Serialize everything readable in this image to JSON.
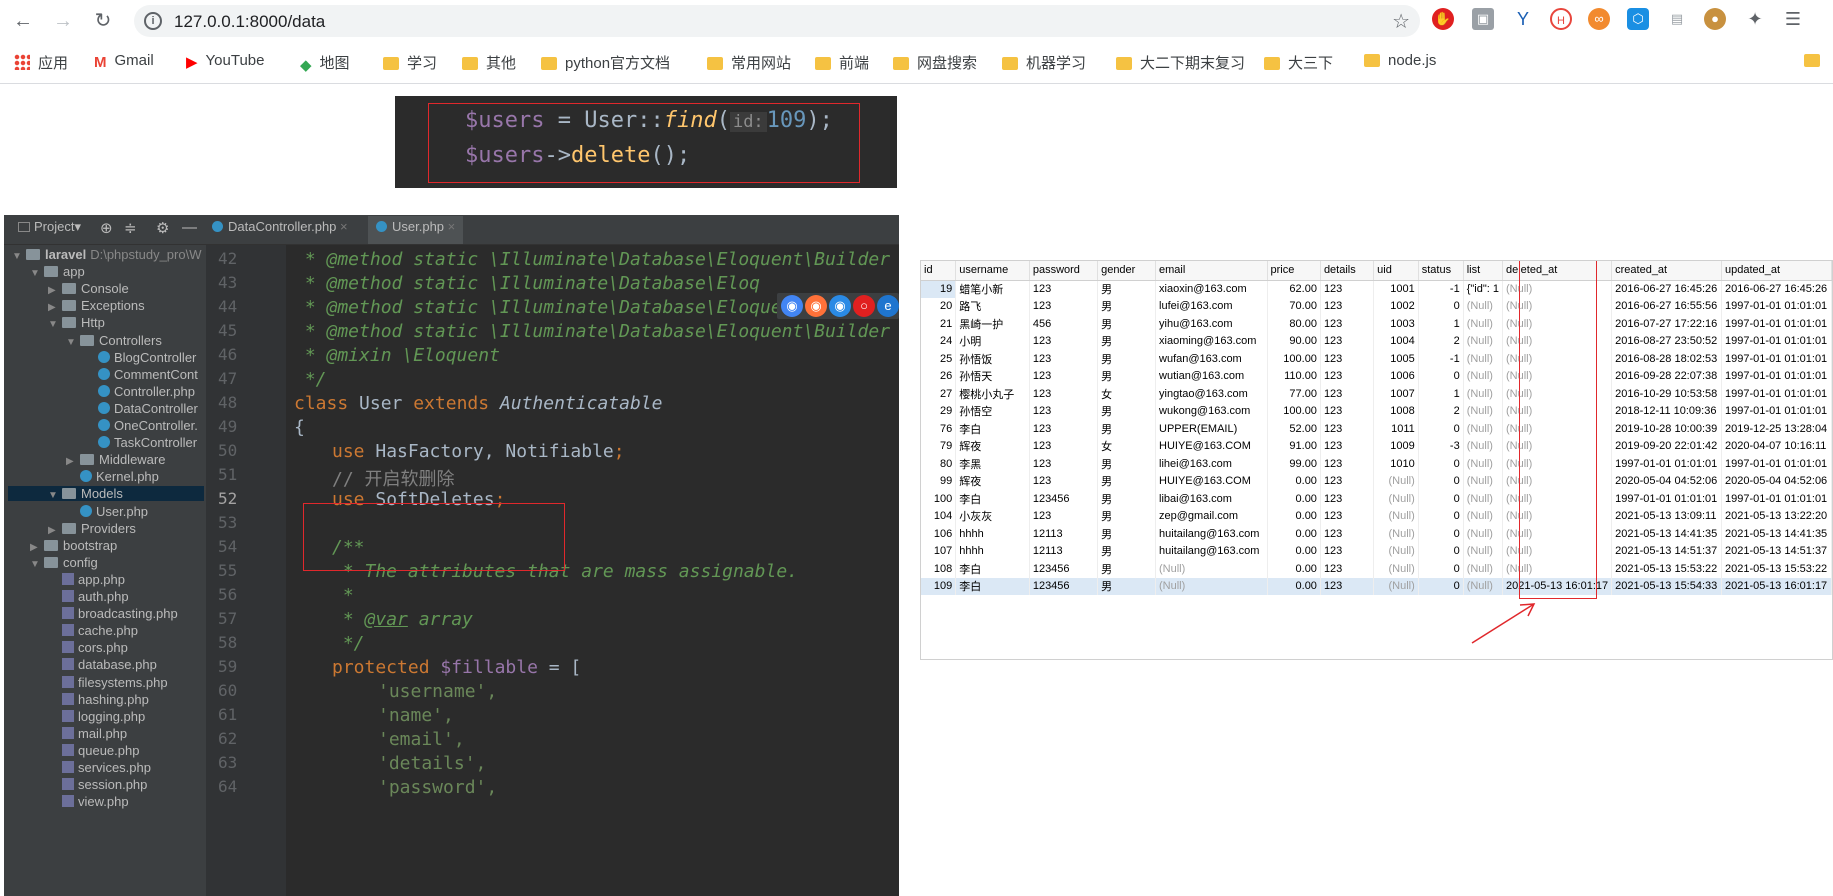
{
  "browser": {
    "url_host": "127.0.0.1",
    "url_path": ":8000/data",
    "bookmarks": [
      "应用",
      "Gmail",
      "YouTube",
      "地图",
      "学习",
      "其他",
      "python官方文档",
      "常用网站",
      "前端",
      "网盘搜索",
      "机器学习",
      "大二下期末复习",
      "大三下",
      "node.js"
    ]
  },
  "snippet": {
    "line1_var": "$users",
    "line1_eq": " = ",
    "line1_cls": "User",
    "line1_op": "::",
    "line1_fn": "find",
    "line1_open": "(",
    "line1_hint": "id:",
    "line1_num": "109",
    "line1_close": ");",
    "line2_var": "$users",
    "line2_arrow": "->",
    "line2_fn": "delete",
    "line2_end": "();"
  },
  "ide": {
    "project_label": "Project▾",
    "tabs": [
      "DataController.php",
      "User.php"
    ],
    "tree": [
      {
        "label": "laravel",
        "extra": "D:\\phpstudy_pro\\W",
        "type": "folder",
        "depth": 0,
        "open": true
      },
      {
        "label": "app",
        "type": "folder",
        "depth": 1,
        "open": true
      },
      {
        "label": "Console",
        "type": "folder",
        "depth": 2,
        "open": false
      },
      {
        "label": "Exceptions",
        "type": "folder",
        "depth": 2,
        "open": false
      },
      {
        "label": "Http",
        "type": "folder",
        "depth": 2,
        "open": true
      },
      {
        "label": "Controllers",
        "type": "folder",
        "depth": 3,
        "open": true
      },
      {
        "label": "BlogController",
        "type": "class",
        "depth": 4
      },
      {
        "label": "CommentCont",
        "type": "class",
        "depth": 4
      },
      {
        "label": "Controller.php",
        "type": "class",
        "depth": 4
      },
      {
        "label": "DataController",
        "type": "class",
        "depth": 4
      },
      {
        "label": "OneController.",
        "type": "class",
        "depth": 4
      },
      {
        "label": "TaskController",
        "type": "class",
        "depth": 4
      },
      {
        "label": "Middleware",
        "type": "folder",
        "depth": 3,
        "open": false
      },
      {
        "label": "Kernel.php",
        "type": "class",
        "depth": 3
      },
      {
        "label": "Models",
        "type": "folder",
        "depth": 2,
        "open": true,
        "selected": true
      },
      {
        "label": "User.php",
        "type": "class",
        "depth": 3
      },
      {
        "label": "Providers",
        "type": "folder",
        "depth": 2,
        "open": false
      },
      {
        "label": "bootstrap",
        "type": "folder",
        "depth": 1,
        "open": false
      },
      {
        "label": "config",
        "type": "folder",
        "depth": 1,
        "open": true
      },
      {
        "label": "app.php",
        "type": "php",
        "depth": 2
      },
      {
        "label": "auth.php",
        "type": "php",
        "depth": 2
      },
      {
        "label": "broadcasting.php",
        "type": "php",
        "depth": 2
      },
      {
        "label": "cache.php",
        "type": "php",
        "depth": 2
      },
      {
        "label": "cors.php",
        "type": "php",
        "depth": 2
      },
      {
        "label": "database.php",
        "type": "php",
        "depth": 2
      },
      {
        "label": "filesystems.php",
        "type": "php",
        "depth": 2
      },
      {
        "label": "hashing.php",
        "type": "php",
        "depth": 2
      },
      {
        "label": "logging.php",
        "type": "php",
        "depth": 2
      },
      {
        "label": "mail.php",
        "type": "php",
        "depth": 2
      },
      {
        "label": "queue.php",
        "type": "php",
        "depth": 2
      },
      {
        "label": "services.php",
        "type": "php",
        "depth": 2
      },
      {
        "label": "session.php",
        "type": "php",
        "depth": 2
      },
      {
        "label": "view.php",
        "type": "php",
        "depth": 2
      }
    ],
    "line_numbers": [
      "42",
      "43",
      "44",
      "45",
      "46",
      "47",
      "48",
      "49",
      "50",
      "51",
      "52",
      "53",
      "54",
      "55",
      "56",
      "57",
      "58",
      "59",
      "60",
      "61",
      "62",
      "63",
      "64"
    ],
    "code": {
      "l42": " * @method static \\Illuminate\\Database\\Eloquent\\Builder",
      "l43": " * @method static \\Illuminate\\Database\\Eloq",
      "l44": " * @method static \\Illuminate\\Database\\Eloquent\\Builder",
      "l45": " * @method static \\Illuminate\\Database\\Eloquent\\Builder",
      "l46": " * @mixin \\Eloquent",
      "l47": " */",
      "l48_kw": "class",
      "l48_name": " User ",
      "l48_ext": "extends",
      "l48_parent": " Authenticatable",
      "l49": "{",
      "l50_kw": "use",
      "l50_rest": " HasFactory, Notifiable",
      "l50_semi": ";",
      "l51": "// 开启软删除",
      "l52_kw": "use",
      "l52_rest": " SoftDeletes",
      "l52_semi": ";",
      "l54": "/**",
      "l55": " * The attributes that are mass assignable.",
      "l56": " *",
      "l57_tag": "@var",
      "l57_rest": " array",
      "l58": " */",
      "l59_kw": "protected",
      "l59_var": " $fillable",
      "l59_rest": " = [",
      "l60": "'username',",
      "l61": "'name',",
      "l62": "'email',",
      "l63": "'details',",
      "l64": "'password',"
    }
  },
  "db": {
    "columns": [
      "id",
      "username",
      "password",
      "gender",
      "email",
      "price",
      "details",
      "uid",
      "status",
      "list",
      "deleted_at",
      "created_at",
      "updated_at"
    ],
    "rows": [
      [
        "19",
        "蜡笔小新",
        "123",
        "男",
        "xiaoxin@163.com",
        "62.00",
        "123",
        "1001",
        "-1",
        "{\"id\": 1",
        "(Null)",
        "2016-06-27 16:45:26",
        "2016-06-27 16:45:26"
      ],
      [
        "20",
        "路飞",
        "123",
        "男",
        "lufei@163.com",
        "70.00",
        "123",
        "1002",
        "0",
        "(Null)",
        "(Null)",
        "2016-06-27 16:55:56",
        "1997-01-01 01:01:01"
      ],
      [
        "21",
        "黑崎一护",
        "456",
        "男",
        "yihu@163.com",
        "80.00",
        "123",
        "1003",
        "1",
        "(Null)",
        "(Null)",
        "2016-07-27 17:22:16",
        "1997-01-01 01:01:01"
      ],
      [
        "24",
        "小明",
        "123",
        "男",
        "xiaoming@163.com",
        "90.00",
        "123",
        "1004",
        "2",
        "(Null)",
        "(Null)",
        "2016-08-27 23:50:52",
        "1997-01-01 01:01:01"
      ],
      [
        "25",
        "孙悟饭",
        "123",
        "男",
        "wufan@163.com",
        "100.00",
        "123",
        "1005",
        "-1",
        "(Null)",
        "(Null)",
        "2016-08-28 18:02:53",
        "1997-01-01 01:01:01"
      ],
      [
        "26",
        "孙悟天",
        "123",
        "男",
        "wutian@163.com",
        "110.00",
        "123",
        "1006",
        "0",
        "(Null)",
        "(Null)",
        "2016-09-28 22:07:38",
        "1997-01-01 01:01:01"
      ],
      [
        "27",
        "樱桃小丸子",
        "123",
        "女",
        "yingtao@163.com",
        "77.00",
        "123",
        "1007",
        "1",
        "(Null)",
        "(Null)",
        "2016-10-29 10:53:58",
        "1997-01-01 01:01:01"
      ],
      [
        "29",
        "孙悟空",
        "123",
        "男",
        "wukong@163.com",
        "100.00",
        "123",
        "1008",
        "2",
        "(Null)",
        "(Null)",
        "2018-12-11 10:09:36",
        "1997-01-01 01:01:01"
      ],
      [
        "76",
        "李白",
        "123",
        "男",
        "UPPER(EMAIL)",
        "52.00",
        "123",
        "1011",
        "0",
        "(Null)",
        "(Null)",
        "2019-10-28 10:00:39",
        "2019-12-25 13:28:04"
      ],
      [
        "79",
        "辉夜",
        "123",
        "女",
        "HUIYE@163.COM",
        "91.00",
        "123",
        "1009",
        "-3",
        "(Null)",
        "(Null)",
        "2019-09-20 22:01:42",
        "2020-04-07 10:16:11"
      ],
      [
        "80",
        "李黑",
        "123",
        "男",
        "lihei@163.com",
        "99.00",
        "123",
        "1010",
        "0",
        "(Null)",
        "(Null)",
        "1997-01-01 01:01:01",
        "1997-01-01 01:01:01"
      ],
      [
        "99",
        "辉夜",
        "123",
        "男",
        "HUIYE@163.COM",
        "0.00",
        "123",
        "(Null)",
        "0",
        "(Null)",
        "(Null)",
        "2020-05-04 04:52:06",
        "2020-05-04 04:52:06"
      ],
      [
        "100",
        "李白",
        "123456",
        "男",
        "libai@163.com",
        "0.00",
        "123",
        "(Null)",
        "0",
        "(Null)",
        "(Null)",
        "1997-01-01 01:01:01",
        "1997-01-01 01:01:01"
      ],
      [
        "104",
        "小灰灰",
        "123",
        "男",
        "zep@gmail.com",
        "0.00",
        "123",
        "(Null)",
        "0",
        "(Null)",
        "(Null)",
        "2021-05-13 13:09:11",
        "2021-05-13 13:22:20"
      ],
      [
        "106",
        "hhhh",
        "12113",
        "男",
        "huitailang@163.com",
        "0.00",
        "123",
        "(Null)",
        "0",
        "(Null)",
        "(Null)",
        "2021-05-13 14:41:35",
        "2021-05-13 14:41:35"
      ],
      [
        "107",
        "hhhh",
        "12113",
        "男",
        "huitailang@163.com",
        "0.00",
        "123",
        "(Null)",
        "0",
        "(Null)",
        "(Null)",
        "2021-05-13 14:51:37",
        "2021-05-13 14:51:37"
      ],
      [
        "108",
        "李白",
        "123456",
        "男",
        "(Null)",
        "0.00",
        "123",
        "(Null)",
        "0",
        "(Null)",
        "(Null)",
        "2021-05-13 15:53:22",
        "2021-05-13 15:53:22"
      ],
      [
        "109",
        "李白",
        "123456",
        "男",
        "(Null)",
        "0.00",
        "123",
        "(Null)",
        "0",
        "(Null)",
        "2021-05-13 16:01:17",
        "2021-05-13 15:54:33",
        "2021-05-13 16:01:17"
      ]
    ]
  }
}
